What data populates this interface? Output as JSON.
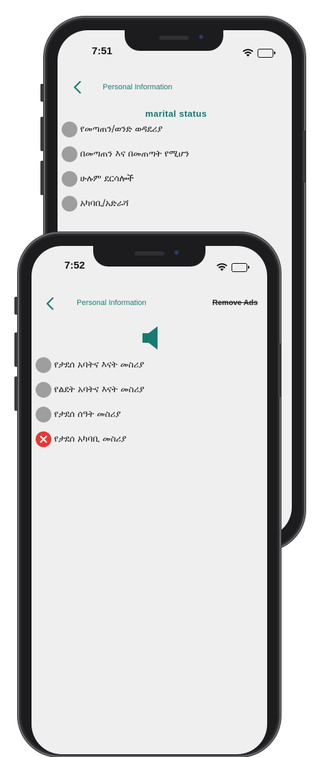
{
  "back_phone": {
    "status_time": "7:51",
    "nav_title": "Personal Information",
    "section_title": "marital status",
    "options": [
      {
        "label": "የመጣጠን/ወንድ ወዳደሪያ"
      },
      {
        "label": "በመጣጠን እና በመጠጣት የሚሆን"
      },
      {
        "label": "ሁሉም ደርሳሎች"
      },
      {
        "label": "አካባቢ/አድራሻ"
      }
    ]
  },
  "front_phone": {
    "status_time": "7:52",
    "nav_title": "Personal Information",
    "remove_ads_label": "Remove Ads",
    "speaker_icon": "speaker-icon",
    "options": [
      {
        "label": "የታደሰ አባትና እናት መስሪያ",
        "state": "neutral"
      },
      {
        "label": "የልደት አባትና እናት መስሪያ",
        "state": "neutral"
      },
      {
        "label": "የታደሰ ሰዓት መስሪያ",
        "state": "neutral"
      },
      {
        "label": "የታደሰ አካባቢ መስሪያ",
        "state": "wrong"
      }
    ]
  },
  "colors": {
    "accent": "#177b70",
    "radio_neutral": "#9e9e9e",
    "radio_wrong": "#e53935",
    "screen_bg": "#efefef"
  }
}
